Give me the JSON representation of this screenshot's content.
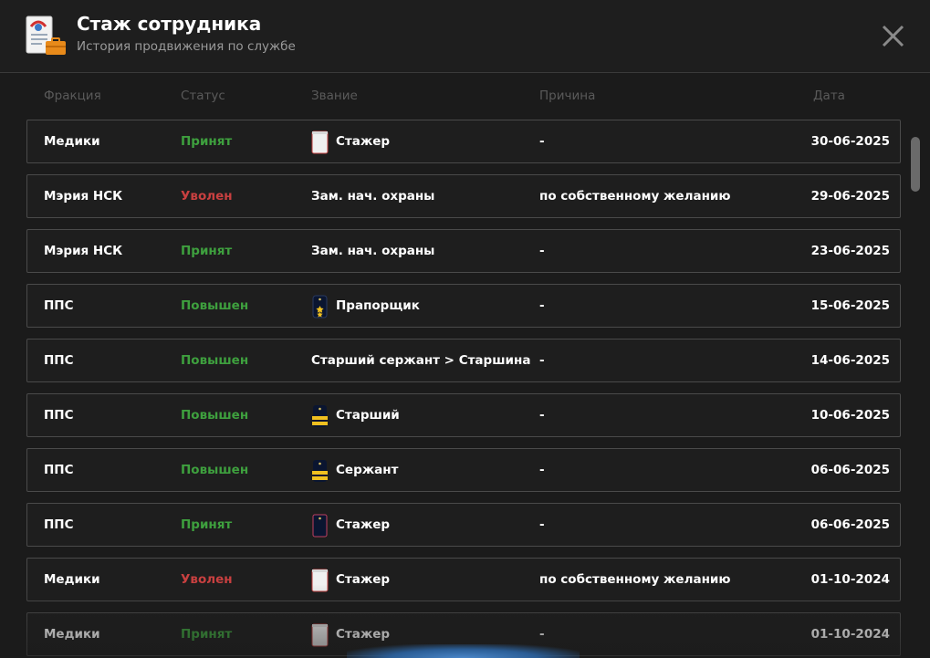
{
  "header": {
    "title": "Стаж сотрудника",
    "subtitle": "История продвижения по службе"
  },
  "columns": {
    "faction": "Фракция",
    "status": "Статус",
    "rank": "Звание",
    "reason": "Причина",
    "date": "Дата"
  },
  "colors": {
    "accepted": "#3ea03e",
    "dismissed": "#c84040",
    "promoted": "#3ea03e",
    "background": "#1b1b1b"
  },
  "rows": [
    {
      "faction": "Медики",
      "status": "Принят",
      "status_type": "accepted",
      "rank": "Стажер",
      "rank_icon": "white-badge-icon",
      "reason": "-",
      "date": "30-06-2025"
    },
    {
      "faction": "Мэрия НСК",
      "status": "Уволен",
      "status_type": "dismissed",
      "rank": "Зам. нач. охраны",
      "rank_icon": "",
      "reason": "по собственному желанию",
      "date": "29-06-2025"
    },
    {
      "faction": "Мэрия НСК",
      "status": "Принят",
      "status_type": "accepted",
      "rank": "Зам. нач. охраны",
      "rank_icon": "",
      "reason": "-",
      "date": "23-06-2025"
    },
    {
      "faction": "ППС",
      "status": "Повышен",
      "status_type": "promoted",
      "rank": "Прапорщик",
      "rank_icon": "two-star-shoulder-board-icon",
      "reason": "-",
      "date": "15-06-2025"
    },
    {
      "faction": "ППС",
      "status": "Повышен",
      "status_type": "promoted",
      "rank": "Старший сержант > Старшина",
      "rank_icon": "",
      "reason": "-",
      "date": "14-06-2025"
    },
    {
      "faction": "ППС",
      "status": "Повышен",
      "status_type": "promoted",
      "rank": "Старший",
      "rank_icon": "stripes-shoulder-board-icon",
      "reason": "-",
      "date": "10-06-2025"
    },
    {
      "faction": "ППС",
      "status": "Повышен",
      "status_type": "promoted",
      "rank": "Сержант",
      "rank_icon": "stripes-shoulder-board-icon",
      "reason": "-",
      "date": "06-06-2025"
    },
    {
      "faction": "ППС",
      "status": "Принят",
      "status_type": "accepted",
      "rank": "Стажер",
      "rank_icon": "plain-shoulder-board-icon",
      "reason": "-",
      "date": "06-06-2025"
    },
    {
      "faction": "Медики",
      "status": "Уволен",
      "status_type": "dismissed",
      "rank": "Стажер",
      "rank_icon": "white-badge-icon",
      "reason": "по собственному желанию",
      "date": "01-10-2024"
    },
    {
      "faction": "Медики",
      "status": "Принят",
      "status_type": "accepted",
      "rank": "Стажер",
      "rank_icon": "white-badge-icon",
      "reason": "-",
      "date": "01-10-2024"
    }
  ]
}
